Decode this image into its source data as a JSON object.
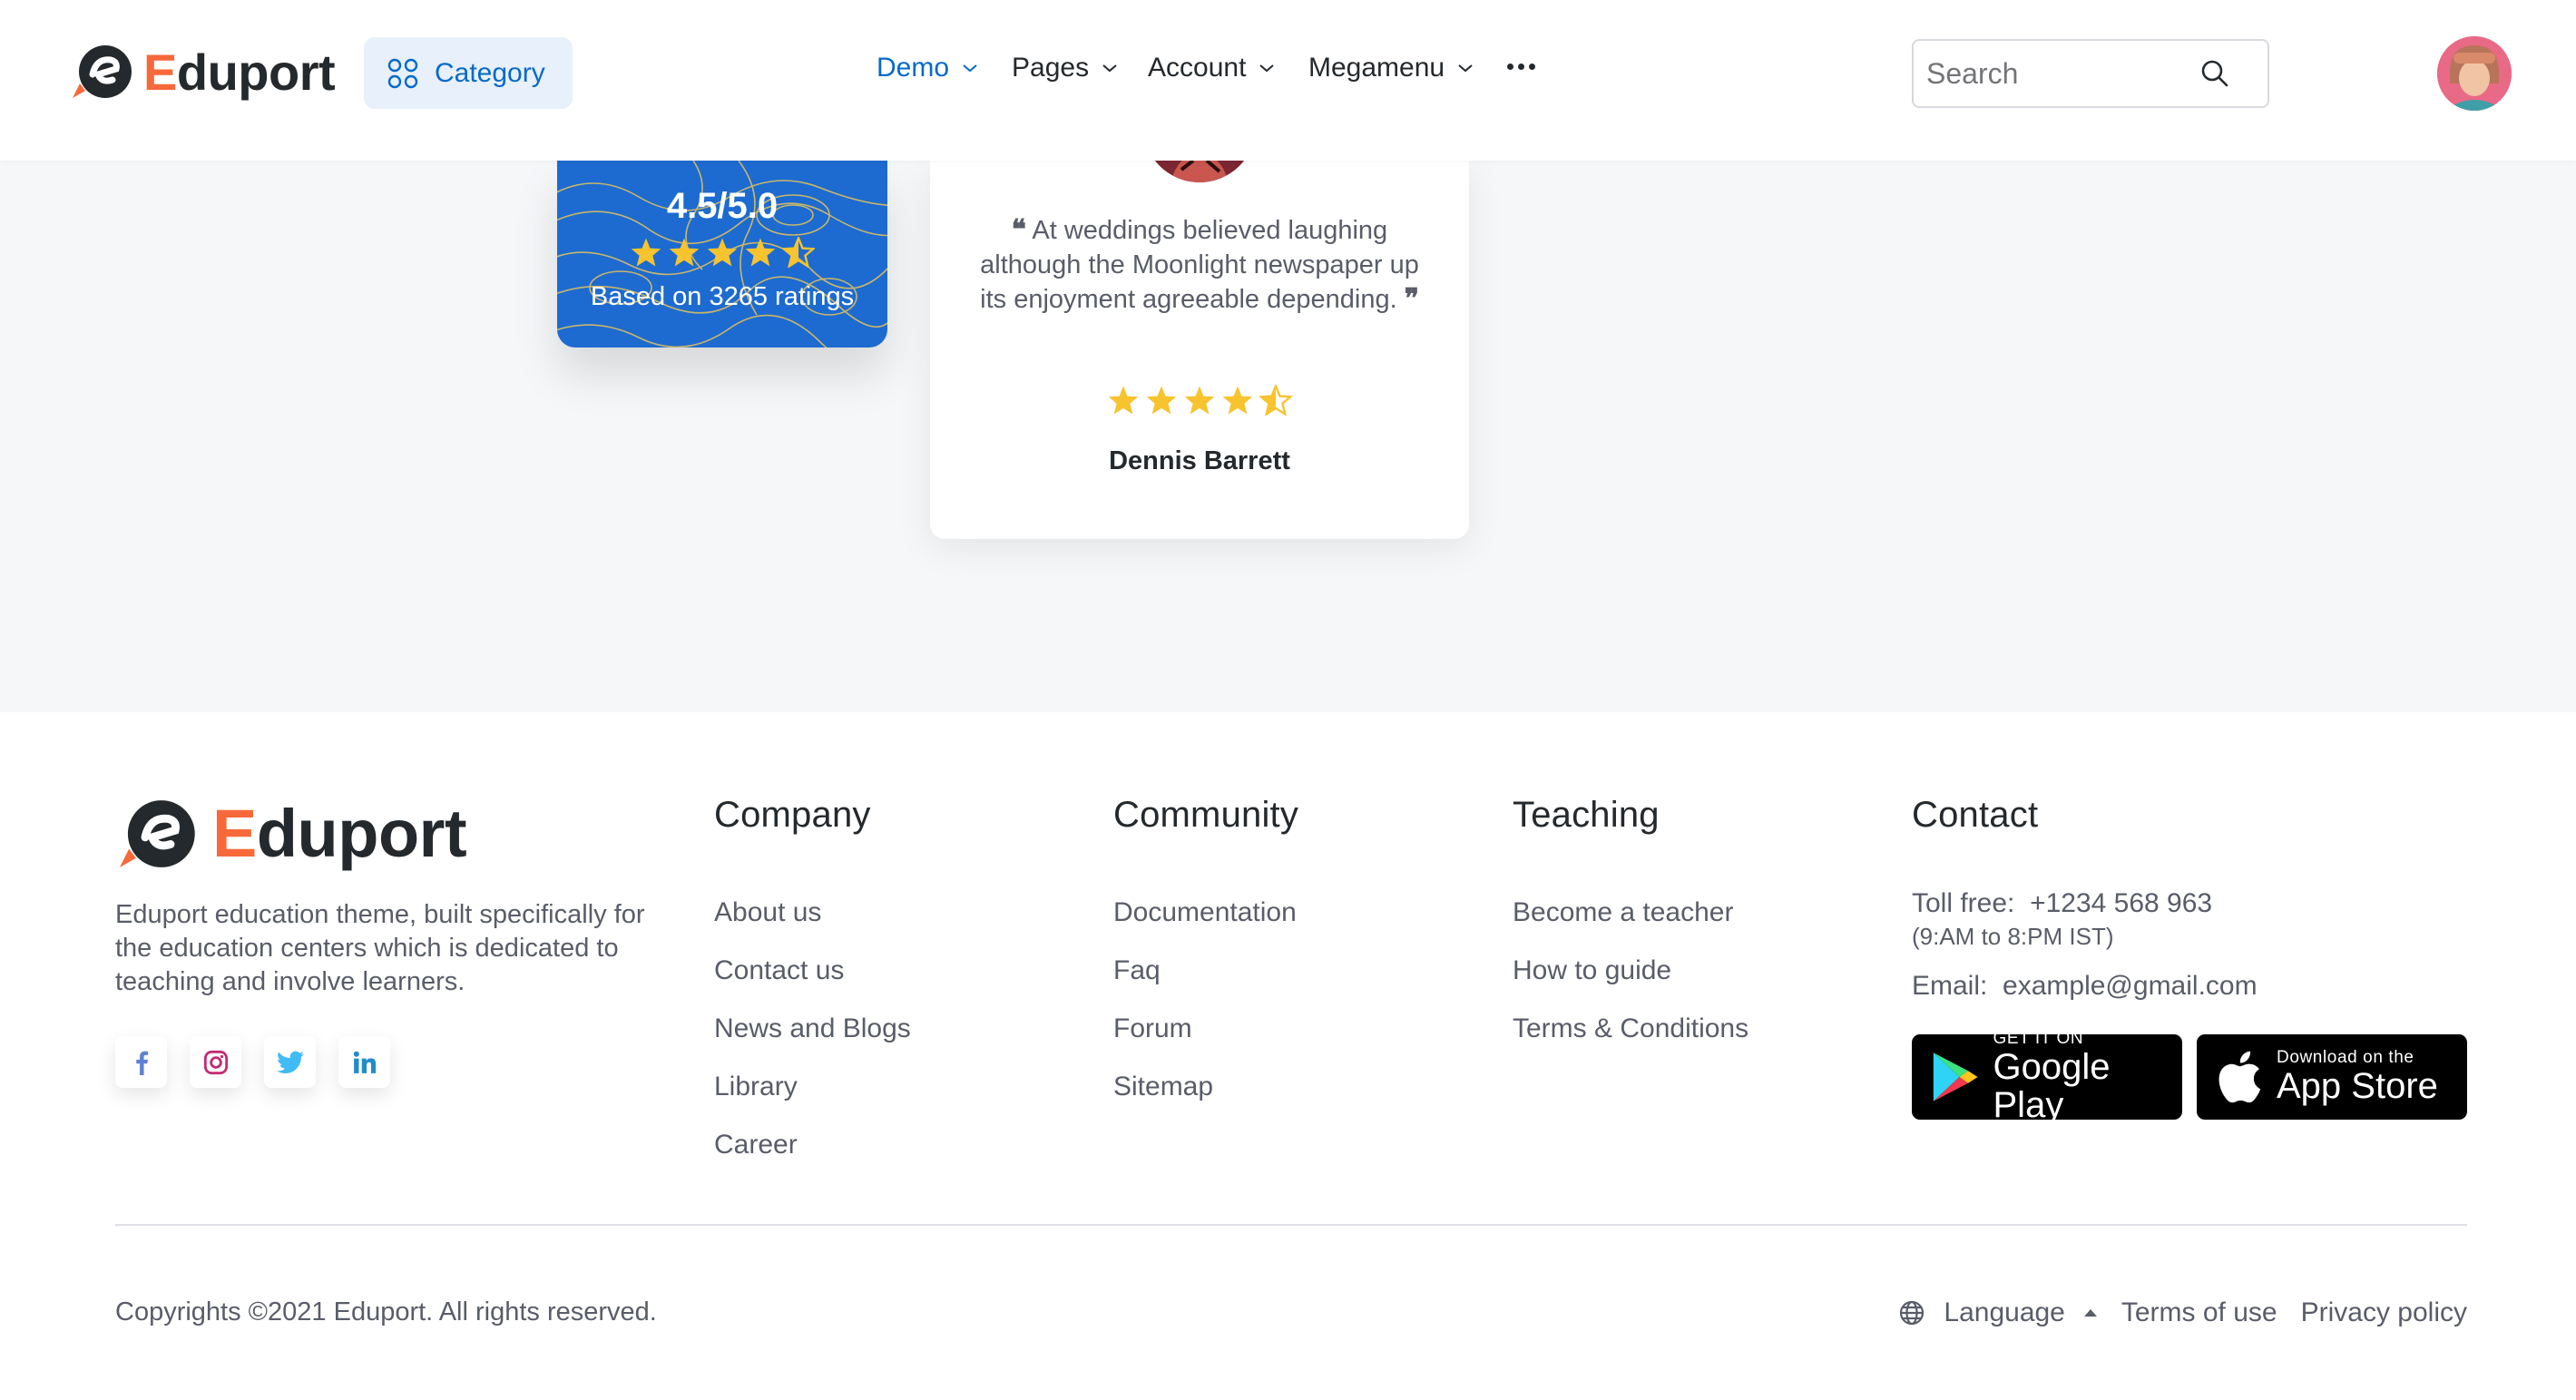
{
  "header": {
    "brand": {
      "first_letter": "E",
      "rest": "duport"
    },
    "category_label": "Category",
    "nav": [
      {
        "label": "Demo",
        "active": true
      },
      {
        "label": "Pages",
        "active": false
      },
      {
        "label": "Account",
        "active": false
      },
      {
        "label": "Megamenu",
        "active": false
      }
    ],
    "more_icon": "more-horizontal-icon",
    "search": {
      "placeholder": "Search",
      "value": ""
    }
  },
  "hero": {
    "rating_card": {
      "value": "4.5/5.0",
      "stars": 4.5,
      "note": "Based on 3265 ratings"
    },
    "testimonial": {
      "quote": "At weddings believed laughing although the Moonlight newspaper up its enjoyment agreeable depending.",
      "stars": 4.5,
      "name": "Dennis Barrett"
    }
  },
  "footer": {
    "brand": {
      "first_letter": "E",
      "rest": "duport"
    },
    "description": "Eduport education theme, built specifically for the education centers which is dedicated to teaching and involve learners.",
    "socials": [
      "facebook-icon",
      "instagram-icon",
      "twitter-icon",
      "linkedin-icon"
    ],
    "company": {
      "title": "Company",
      "links": [
        "About us",
        "Contact us",
        "News and Blogs",
        "Library",
        "Career"
      ]
    },
    "community": {
      "title": "Community",
      "links": [
        "Documentation",
        "Faq",
        "Forum",
        "Sitemap"
      ]
    },
    "teaching": {
      "title": "Teaching",
      "links": [
        "Become a teacher",
        "How to guide",
        "Terms & Conditions"
      ]
    },
    "contact": {
      "title": "Contact",
      "toll_free_label": "Toll free:",
      "toll_free_value": "+1234 568 963",
      "hours": "(9:AM to 8:PM IST)",
      "email_label": "Email:",
      "email_value": "example@gmail.com",
      "google_play": {
        "small": "GET IT ON",
        "big": "Google Play"
      },
      "app_store": {
        "small": "Download on the",
        "big": "App Store"
      }
    },
    "copyright": "Copyrights ©2021 Eduport. All rights reserved.",
    "bottom_links": {
      "language": "Language",
      "terms": "Terms of use",
      "privacy": "Privacy policy"
    }
  },
  "colors": {
    "primary": "#066ac9",
    "brand_orange": "#f7693a",
    "dark": "#24292d",
    "star": "#f7c32e",
    "body_text": "#595d69"
  }
}
